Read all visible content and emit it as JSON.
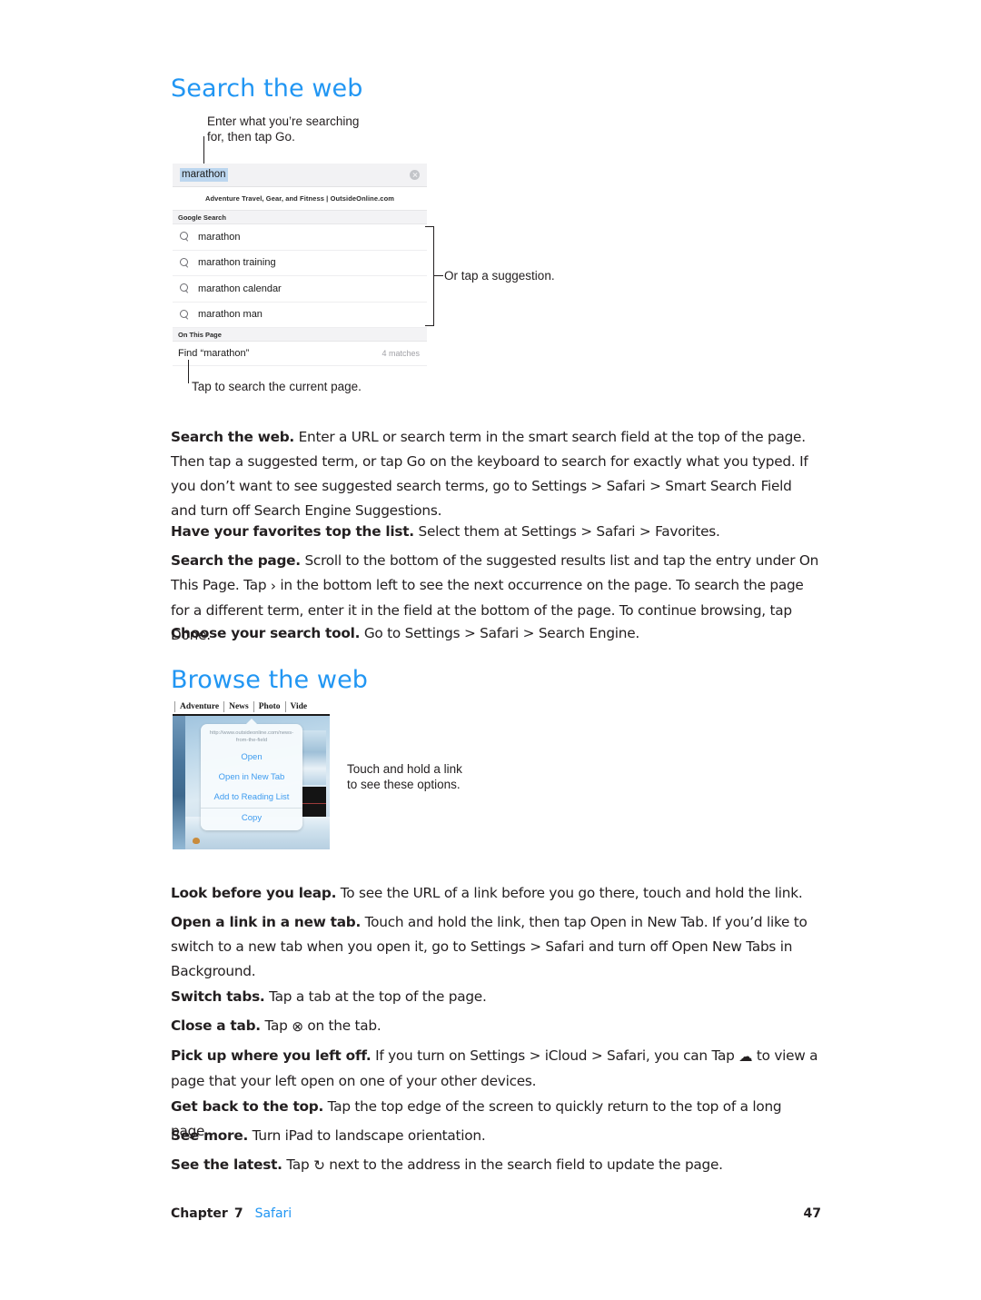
{
  "headings": {
    "search_the_web": "Search the web",
    "browse_the_web": "Browse the web"
  },
  "callouts": {
    "enter_search": "Enter what you’re searching\nfor, then tap Go.",
    "or_tap_suggestion": "Or tap a suggestion.",
    "tap_search_current_page": "Tap to search the current page.",
    "touch_and_hold": "Touch and hold a link\nto see these options."
  },
  "search_mockup": {
    "field_value": "marathon",
    "clear_icon": "clear-circle-icon",
    "top_result_title": "Adventure Travel, Gear, and Fitness | OutsideOnline.com",
    "group_google": "Google Search",
    "suggestions": [
      "marathon",
      "marathon training",
      "marathon calendar",
      "marathon man"
    ],
    "group_on_this_page": "On This Page",
    "find_label": "Find “marathon”",
    "find_count": "4 matches"
  },
  "browse_mockup": {
    "tabs": [
      "Adventure",
      "News",
      "Photo",
      "Vide"
    ],
    "url": "http://www.outsideonline.com/news-from-the-field",
    "menu_items": [
      "Open",
      "Open in New Tab",
      "Add to Reading List",
      "Copy"
    ]
  },
  "body": {
    "p1": {
      "lead": "Search the web.",
      "text": " Enter a URL or search term in the smart search field at the top of the page. Then tap a suggested term, or tap Go on the keyboard to search for exactly what you typed. If you don’t want to see suggested search terms, go to Settings > Safari > Smart Search Field and turn off Search Engine Suggestions."
    },
    "p2": {
      "lead": "Have your favorites top the list.",
      "text": " Select them at Settings > Safari > Favorites."
    },
    "p3": {
      "lead": "Search the page.",
      "text_a": " Scroll to the bottom of the suggested results list and tap the entry under On This Page. Tap ",
      "glyph": "›",
      "glyph_name": "chevron-right-icon",
      "text_b": " in the bottom left to see the next occurrence on the page. To search the page for a different term, enter it in the field at the bottom of the page. To continue browsing, tap Done."
    },
    "p4": {
      "lead": "Choose your search tool.",
      "text": " Go to Settings > Safari > Search Engine."
    },
    "p5": {
      "lead": "Look before you leap.",
      "text": " To see the URL of a link before you go there, touch and hold the link."
    },
    "p6": {
      "lead": "Open a link in a new tab.",
      "text": " Touch and hold the link, then tap Open in New Tab. If you’d like to switch to a new tab when you open it, go to Settings > Safari and turn off Open New Tabs in Background."
    },
    "p7": {
      "lead": "Switch tabs.",
      "text": " Tap a tab at the top of the page."
    },
    "p8": {
      "lead": "Close a tab.",
      "text_a": " Tap ",
      "glyph": "⊗",
      "glyph_name": "close-circle-icon",
      "text_b": " on the tab."
    },
    "p9": {
      "lead": "Pick up where you left off.",
      "text_a": " If you turn on Settings > iCloud > Safari, you can Tap ",
      "glyph": "☁",
      "glyph_name": "icloud-tabs-icon",
      "text_b": " to view a page that your left open on one of your other devices."
    },
    "p10": {
      "lead": "Get back to the top.",
      "text": " Tap the top edge of the screen to quickly return to the top of a long page."
    },
    "p11": {
      "lead": "See more.",
      "text": " Turn iPad to landscape orientation."
    },
    "p12": {
      "lead": "See the latest.",
      "text_a": " Tap ",
      "glyph": "↻",
      "glyph_name": "refresh-icon",
      "text_b": " next to the address in the search field to update the page."
    }
  },
  "footer": {
    "chapter_label": "Chapter",
    "chapter_number": "7",
    "chapter_name": "Safari",
    "page_number": "47"
  },
  "colors": {
    "heading_blue": "#2196f3",
    "link_blue": "#2196f3",
    "ios_blue": "#3d9bef",
    "text": "#231f20"
  }
}
